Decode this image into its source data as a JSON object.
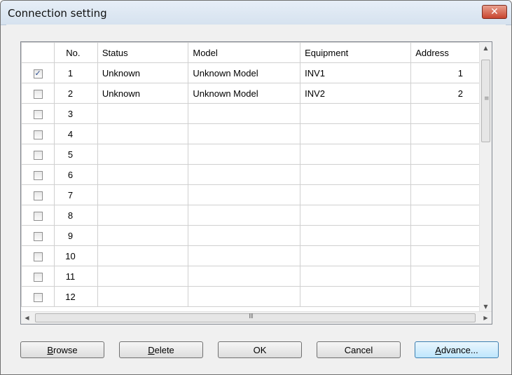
{
  "window": {
    "title": "Connection setting",
    "close_glyph": "✕"
  },
  "grid": {
    "columns": [
      "",
      "No.",
      "Status",
      "Model",
      "Equipment",
      "Address"
    ],
    "rows": [
      {
        "checked": true,
        "no": "1",
        "status": "Unknown",
        "model": "Unknown Model",
        "equipment": "INV1",
        "address": "1"
      },
      {
        "checked": false,
        "no": "2",
        "status": "Unknown",
        "model": "Unknown Model",
        "equipment": "INV2",
        "address": "2"
      },
      {
        "checked": false,
        "no": "3",
        "status": "",
        "model": "",
        "equipment": "",
        "address": ""
      },
      {
        "checked": false,
        "no": "4",
        "status": "",
        "model": "",
        "equipment": "",
        "address": ""
      },
      {
        "checked": false,
        "no": "5",
        "status": "",
        "model": "",
        "equipment": "",
        "address": ""
      },
      {
        "checked": false,
        "no": "6",
        "status": "",
        "model": "",
        "equipment": "",
        "address": ""
      },
      {
        "checked": false,
        "no": "7",
        "status": "",
        "model": "",
        "equipment": "",
        "address": ""
      },
      {
        "checked": false,
        "no": "8",
        "status": "",
        "model": "",
        "equipment": "",
        "address": ""
      },
      {
        "checked": false,
        "no": "9",
        "status": "",
        "model": "",
        "equipment": "",
        "address": ""
      },
      {
        "checked": false,
        "no": "10",
        "status": "",
        "model": "",
        "equipment": "",
        "address": ""
      },
      {
        "checked": false,
        "no": "11",
        "status": "",
        "model": "",
        "equipment": "",
        "address": ""
      },
      {
        "checked": false,
        "no": "12",
        "status": "",
        "model": "",
        "equipment": "",
        "address": ""
      }
    ]
  },
  "scrollbars": {
    "up_arrow": "▲",
    "down_arrow": "▼",
    "left_arrow": "◀",
    "right_arrow": "▶",
    "v_grip": "≡",
    "h_grip": "III"
  },
  "buttons": {
    "browse": {
      "mnemonic": "B",
      "rest": "rowse"
    },
    "delete": {
      "mnemonic": "D",
      "rest": "elete"
    },
    "ok": {
      "label": "OK"
    },
    "cancel": {
      "label": "Cancel"
    },
    "advance": {
      "mnemonic": "A",
      "rest": "dvance..."
    }
  }
}
